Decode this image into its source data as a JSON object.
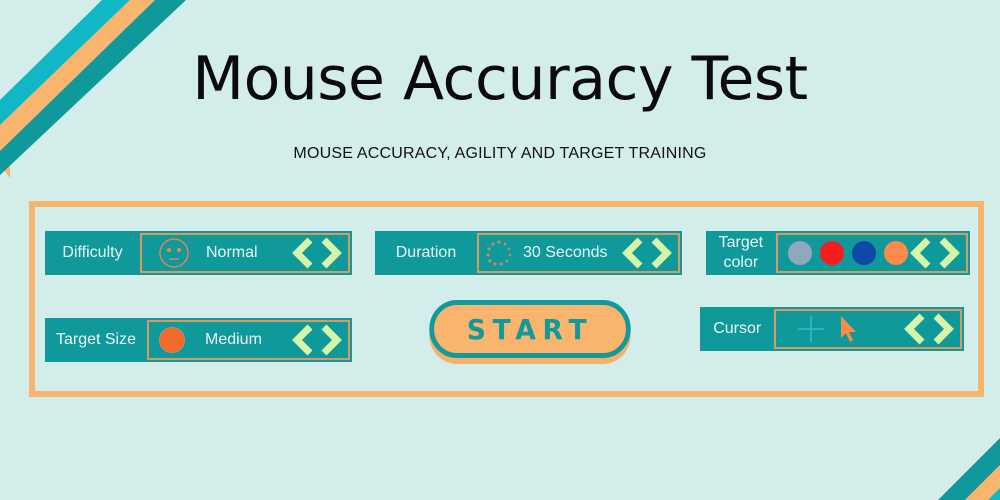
{
  "page": {
    "title": "Mouse Accuracy Test",
    "subtitle": "MOUSE ACCURACY, AGILITY AND TARGET TRAINING"
  },
  "colors": {
    "background": "#d3edeb",
    "teal": "#10999b",
    "orange": "#f7b46c",
    "arrow_green": "#d6f5a8"
  },
  "controls": {
    "difficulty": {
      "label": "Difficulty",
      "value": "Normal",
      "icon": "neutral-face-icon"
    },
    "duration": {
      "label": "Duration",
      "value": "30 Seconds",
      "icon": "loading-spinner-icon"
    },
    "target_color": {
      "label": "Target color",
      "options": [
        {
          "name": "gray-blue",
          "color": "#8fa8bd"
        },
        {
          "name": "red",
          "color": "#f71d1d"
        },
        {
          "name": "blue",
          "color": "#0d4aa7"
        },
        {
          "name": "orange",
          "color": "#fb8b4b"
        }
      ]
    },
    "target_size": {
      "label": "Target Size",
      "value": "Medium",
      "icon": "target-dot-icon",
      "dot_color": "#f26a2c"
    },
    "cursor": {
      "label": "Cursor",
      "options": [
        {
          "name": "crosshair",
          "icon": "crosshair-icon"
        },
        {
          "name": "arrow",
          "icon": "pointer-arrow-icon"
        }
      ]
    }
  },
  "start_button": {
    "label": "START"
  }
}
